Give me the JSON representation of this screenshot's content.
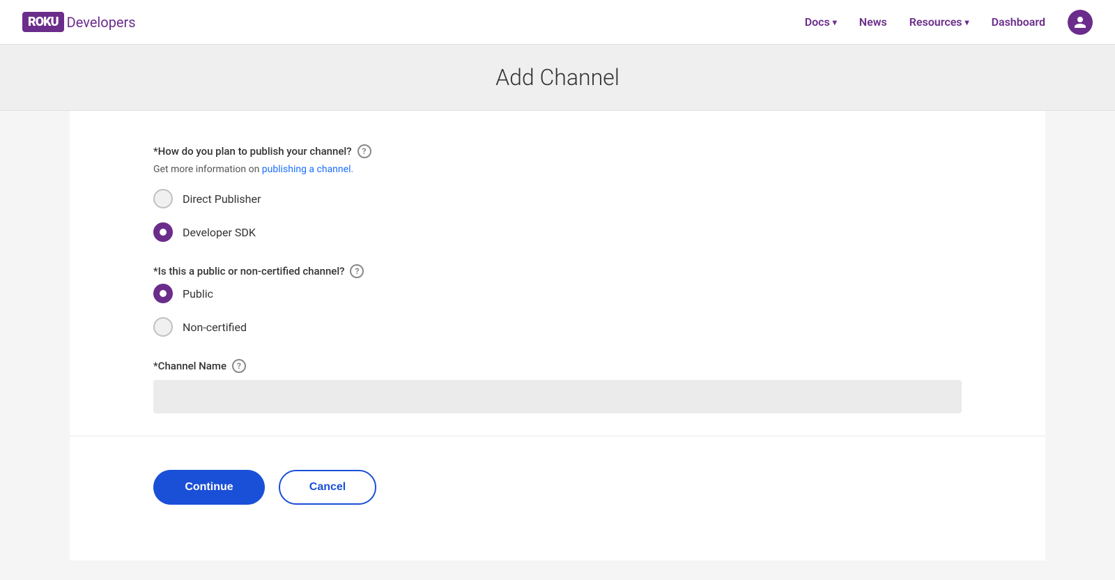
{
  "nav": {
    "logo_text": "ROKU",
    "brand_text": "Developers",
    "links": [
      {
        "label": "Docs",
        "has_chevron": true,
        "id": "docs"
      },
      {
        "label": "News",
        "has_chevron": false,
        "id": "news"
      },
      {
        "label": "Resources",
        "has_chevron": true,
        "id": "resources"
      },
      {
        "label": "Dashboard",
        "has_chevron": false,
        "id": "dashboard"
      }
    ],
    "avatar_icon": "👤"
  },
  "page": {
    "title": "Add Channel"
  },
  "form": {
    "publish_question": "*How do you plan to publish your channel?",
    "publish_hint_prefix": "Get more information on ",
    "publish_hint_link": "publishing a channel.",
    "publish_options": [
      {
        "label": "Direct Publisher",
        "selected": false,
        "id": "direct-publisher"
      },
      {
        "label": "Developer SDK",
        "selected": true,
        "id": "developer-sdk"
      }
    ],
    "channel_type_question": "*Is this a public or non-certified channel?",
    "channel_type_options": [
      {
        "label": "Public",
        "selected": true,
        "id": "public"
      },
      {
        "label": "Non-certified",
        "selected": false,
        "id": "non-certified"
      }
    ],
    "channel_name_label": "*Channel Name",
    "channel_name_placeholder": "",
    "channel_name_value": ""
  },
  "buttons": {
    "continue_label": "Continue",
    "cancel_label": "Cancel"
  }
}
